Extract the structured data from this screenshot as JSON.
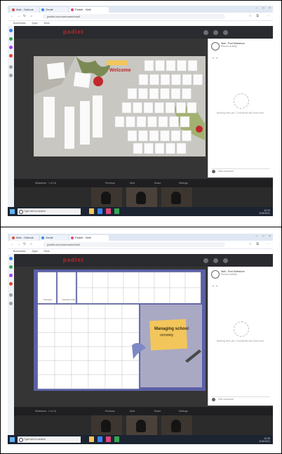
{
  "panels": [
    {
      "browser": {
        "tabs": [
          "Mail - Outlook",
          "Gmail",
          "Padlet - Wall"
        ],
        "url": "padlet.com/username/wall",
        "bookmarks": [
          "Bookmarks",
          "Apps",
          "Work"
        ]
      },
      "app": {
        "brand": "padlet",
        "slide_banner": "Welcome",
        "side_panel": {
          "name": "Wall - Post Slideshow",
          "subtitle": "Recent activity",
          "stats": "0 · 0",
          "empty_text": "Nothing here yet. Comments will show here.",
          "comment_placeholder": "Add comment"
        },
        "bottom_info": [
          "Slideshow · 1 of 16",
          "Previous",
          "Next",
          "Share",
          "Settings"
        ]
      },
      "taskbar": {
        "search_placeholder": "Type here to search",
        "time": "10:24",
        "date": "3/15/2021"
      }
    },
    {
      "browser": {
        "tabs": [
          "Mail - Outlook",
          "Gmail",
          "Padlet - Wall"
        ],
        "url": "padlet.com/username/wall",
        "bookmarks": [
          "Bookmarks",
          "Apps",
          "Work"
        ]
      },
      "app": {
        "brand": "padlet",
        "note_title": "Managing school",
        "note_lines": [
          "remotely"
        ],
        "grid_labels": [
          "Schedule",
          "Important links"
        ],
        "side_panel": {
          "name": "Wall - Post Slideshow",
          "subtitle": "Recent activity",
          "stats": "0 · 0",
          "empty_text": "Nothing here yet. Comments will show here.",
          "comment_placeholder": "Add comment"
        },
        "bottom_info": [
          "Slideshow · 2 of 16",
          "Previous",
          "Next",
          "Share",
          "Settings"
        ]
      },
      "taskbar": {
        "search_placeholder": "Type here to search",
        "time": "10:25",
        "date": "3/15/2021"
      }
    }
  ],
  "colors": {
    "taskbar": "#1c2331",
    "app_bg": "#3a3a3a",
    "accent_red": "#c1272d",
    "slide2_bg": "#5b60a6",
    "sticky_note": "#f2c65b"
  }
}
